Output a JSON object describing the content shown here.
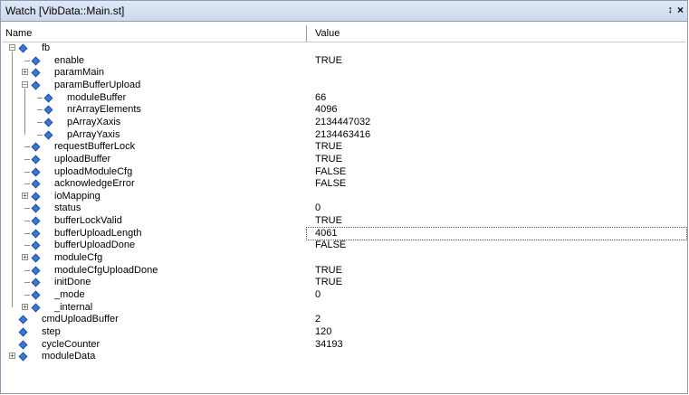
{
  "window": {
    "title": "Watch [VibData::Main.st]",
    "pin_glyph": "↕",
    "close_glyph": "×"
  },
  "columns": {
    "name": "Name",
    "value": "Value"
  },
  "rows": [
    {
      "label": "fb",
      "value": "",
      "level": 0,
      "expander": "minus"
    },
    {
      "label": "enable",
      "value": "TRUE",
      "level": 1
    },
    {
      "label": "paramMain",
      "value": "",
      "level": 1,
      "expander": "plus"
    },
    {
      "label": "paramBufferUpload",
      "value": "",
      "level": 1,
      "expander": "minus"
    },
    {
      "label": "moduleBuffer",
      "value": "66",
      "level": 2
    },
    {
      "label": "nrArrayElements",
      "value": "4096",
      "level": 2
    },
    {
      "label": "pArrayXaxis",
      "value": "2134447032",
      "level": 2
    },
    {
      "label": "pArrayYaxis",
      "value": "2134463416",
      "level": 2
    },
    {
      "label": "requestBufferLock",
      "value": "TRUE",
      "level": 1
    },
    {
      "label": "uploadBuffer",
      "value": "TRUE",
      "level": 1
    },
    {
      "label": "uploadModuleCfg",
      "value": "FALSE",
      "level": 1
    },
    {
      "label": "acknowledgeError",
      "value": "FALSE",
      "level": 1
    },
    {
      "label": "ioMapping",
      "value": "",
      "level": 1,
      "expander": "plus"
    },
    {
      "label": "status",
      "value": "0",
      "level": 1
    },
    {
      "label": "bufferLockValid",
      "value": "TRUE",
      "level": 1
    },
    {
      "label": "bufferUploadLength",
      "value": "4061",
      "level": 1,
      "selected": true
    },
    {
      "label": "bufferUploadDone",
      "value": "FALSE",
      "level": 1
    },
    {
      "label": "moduleCfg",
      "value": "",
      "level": 1,
      "expander": "plus"
    },
    {
      "label": "moduleCfgUploadDone",
      "value": "TRUE",
      "level": 1
    },
    {
      "label": "initDone",
      "value": "TRUE",
      "level": 1
    },
    {
      "label": "_mode",
      "value": "0",
      "level": 1
    },
    {
      "label": "_internal",
      "value": "",
      "level": 1,
      "expander": "plus"
    },
    {
      "label": "cmdUploadBuffer",
      "value": "2",
      "level": 0
    },
    {
      "label": "step",
      "value": "120",
      "level": 0
    },
    {
      "label": "cycleCounter",
      "value": "34193",
      "level": 0
    },
    {
      "label": "moduleData",
      "value": "",
      "level": 0,
      "expander": "plus"
    }
  ],
  "colors": {
    "icon": "#3a78d8",
    "title_bg": "#dfe8f6",
    "border": "#8a9bb4"
  }
}
